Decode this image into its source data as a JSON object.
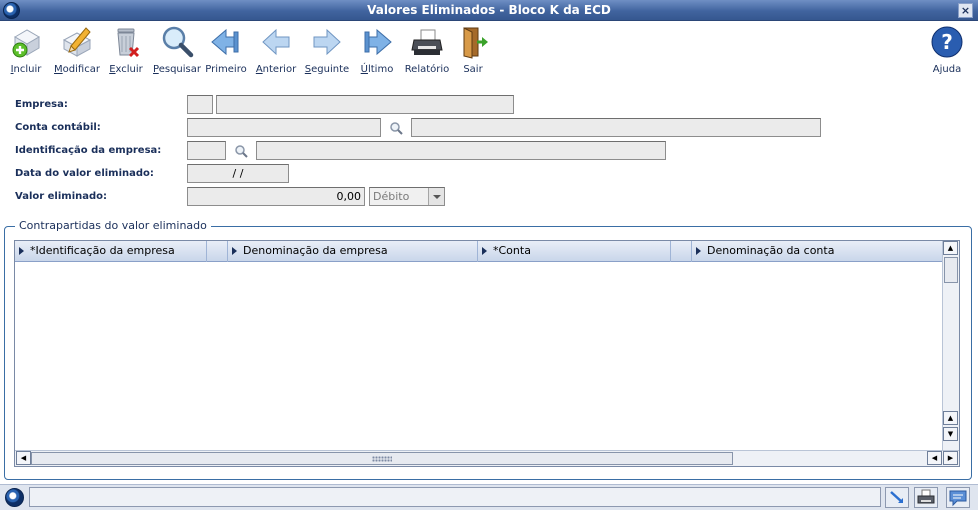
{
  "window": {
    "title": "Valores Eliminados - Bloco K da ECD",
    "close_label": "×"
  },
  "toolbar": {
    "buttons": [
      {
        "key": "incluir",
        "label": "Incluir",
        "accel": "I",
        "icon": "add-document-icon"
      },
      {
        "key": "modificar",
        "label": "Modificar",
        "accel": "M",
        "icon": "edit-pencil-icon"
      },
      {
        "key": "excluir",
        "label": "Excluir",
        "accel": "E",
        "icon": "trash-delete-icon"
      },
      {
        "key": "pesquisar",
        "label": "Pesquisar",
        "accel": "P",
        "icon": "magnifier-icon"
      },
      {
        "key": "primeiro",
        "label": "Primeiro",
        "accel": "",
        "icon": "first-record-icon"
      },
      {
        "key": "anterior",
        "label": "Anterior",
        "accel": "A",
        "icon": "previous-record-icon"
      },
      {
        "key": "seguinte",
        "label": "Seguinte",
        "accel": "S",
        "icon": "next-record-icon"
      },
      {
        "key": "ultimo",
        "label": "Último",
        "accel": "Ú",
        "icon": "last-record-icon"
      },
      {
        "key": "relatorio",
        "label": "Relatório",
        "accel": "",
        "icon": "printer-icon"
      },
      {
        "key": "sair",
        "label": "Sair",
        "accel": "",
        "icon": "exit-door-icon"
      }
    ],
    "help": {
      "label": "Ajuda",
      "icon": "help-question-icon"
    }
  },
  "form": {
    "empresa": {
      "label": "Empresa:",
      "code": "",
      "name": ""
    },
    "conta_contabil": {
      "label": "Conta contábil:",
      "code": "",
      "name": ""
    },
    "identificacao_empresa": {
      "label": "Identificação da empresa:",
      "code": "",
      "name": ""
    },
    "data_valor": {
      "label": "Data do valor eliminado:",
      "value": "/ /"
    },
    "valor_eliminado": {
      "label": "Valor eliminado:",
      "value": "0,00",
      "type_selected": "Débito"
    }
  },
  "contrapartidas": {
    "title": "Contrapartidas do valor eliminado",
    "columns": [
      "*Identificação da empresa",
      "Denominação da empresa",
      "*Conta",
      "Denominação da conta"
    ],
    "rows": []
  },
  "statusbar": {
    "message": ""
  }
}
